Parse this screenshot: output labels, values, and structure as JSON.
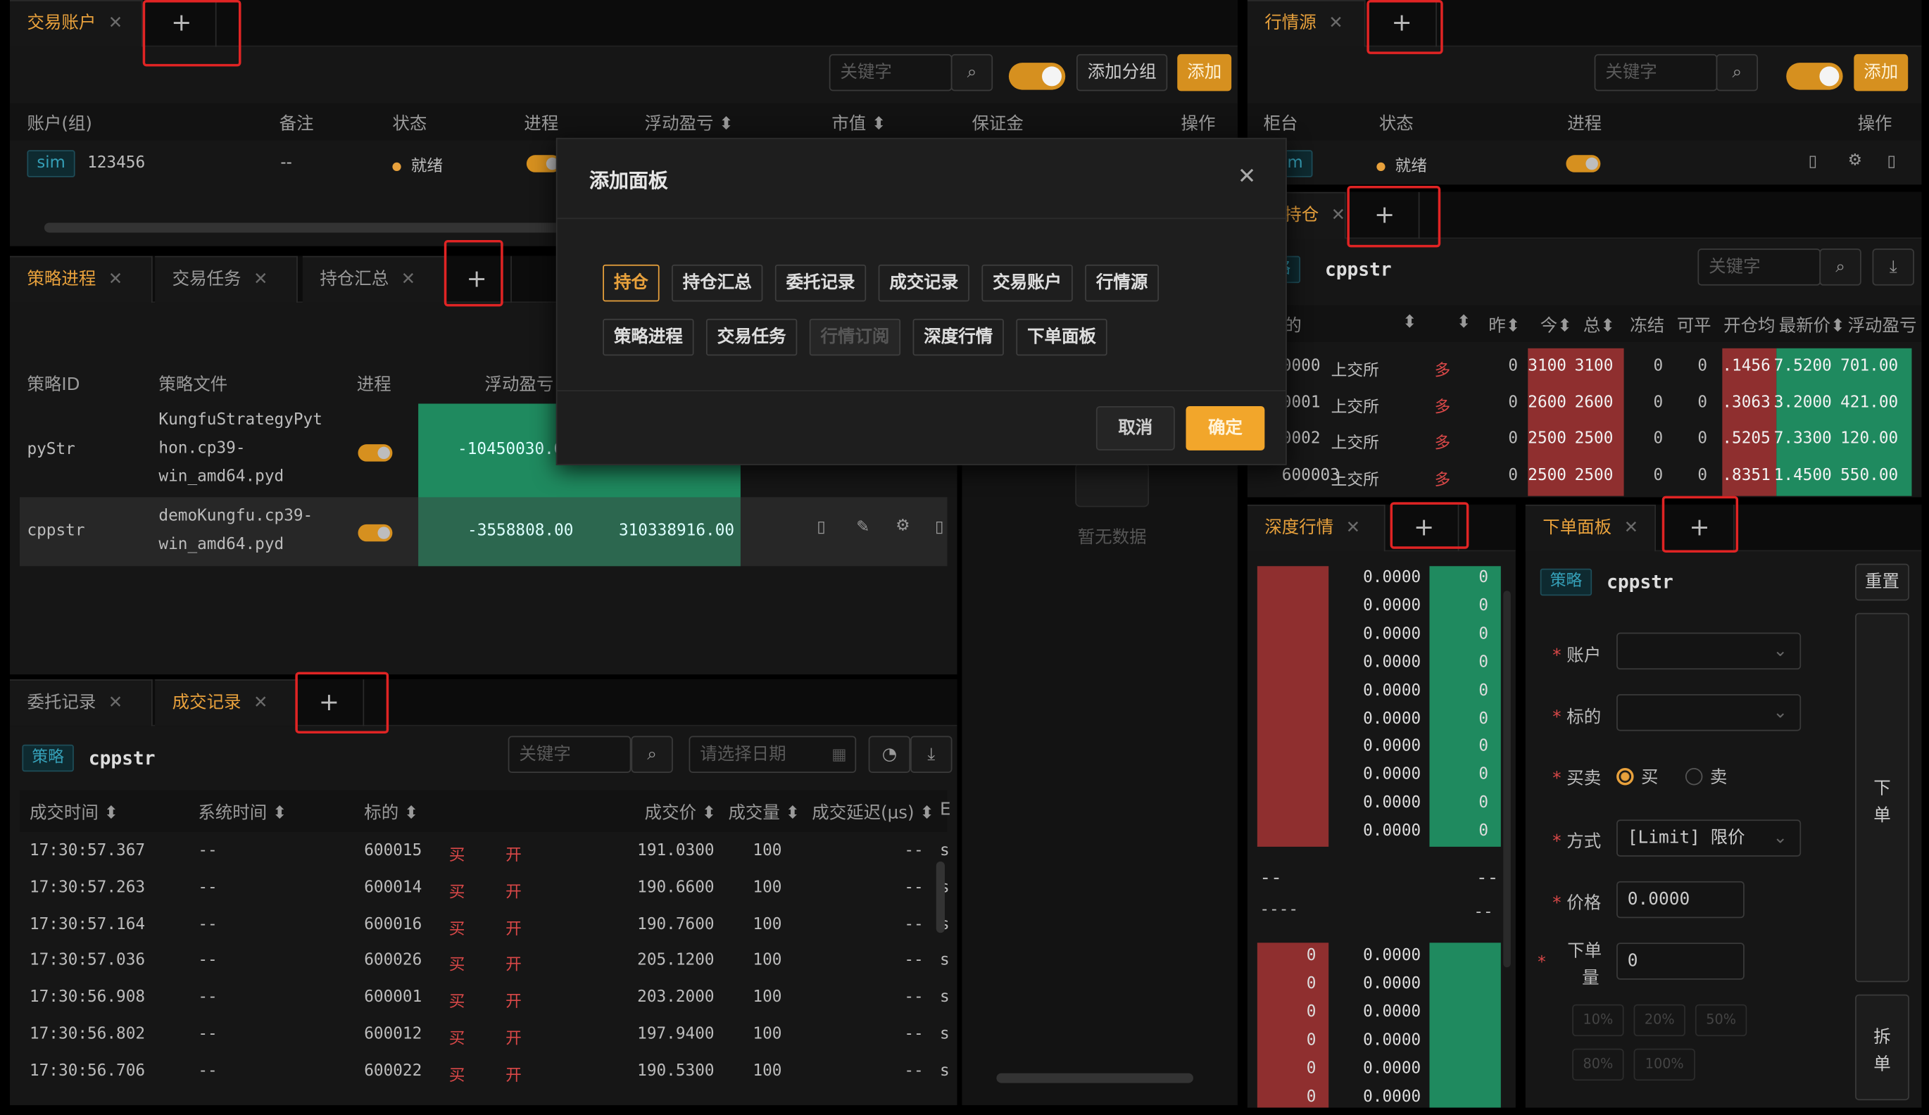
{
  "tabs": {
    "account": [
      {
        "label": "交易账户"
      }
    ],
    "quote_source": [
      {
        "label": "行情源"
      }
    ],
    "strategy": [
      {
        "label": "策略进程"
      },
      {
        "label": "交易任务"
      },
      {
        "label": "持仓汇总"
      }
    ],
    "orders": [
      {
        "label": "委托记录"
      },
      {
        "label": "成交记录"
      }
    ],
    "position": [
      {
        "label": "持仓"
      }
    ],
    "depth": [
      {
        "label": "深度行情"
      }
    ],
    "order_panel": [
      {
        "label": "下单面板"
      }
    ],
    "plus": "+",
    "close": "✕"
  },
  "account_panel": {
    "keyword_placeholder": "关键字",
    "add_group": "添加分组",
    "add": "添加",
    "headers": [
      "账户(组)",
      "备注",
      "状态",
      "进程",
      "浮动盈亏 ⬍",
      "市值 ⬍",
      "保证金",
      "操作"
    ],
    "row": {
      "tag": "sim",
      "id": "123456",
      "note": "--",
      "status": "就绪"
    }
  },
  "quote_panel": {
    "keyword_placeholder": "关键字",
    "add": "添加",
    "headers": [
      "柜台",
      "状态",
      "进程",
      "操作"
    ],
    "row": {
      "tag": "sim",
      "status": "就绪"
    }
  },
  "strategy_panel": {
    "headers": [
      "策略ID",
      "策略文件",
      "进程",
      "浮动盈亏"
    ],
    "rows": [
      {
        "id": "pyStr",
        "file": [
          "KungfuStrategyPyt",
          "hon.cp39-",
          "win_amd64.pyd"
        ],
        "pnl": "-10450030.0"
      },
      {
        "id": "cppstr",
        "file": [
          "demoKungfu.cp39-",
          "win_amd64.pyd"
        ],
        "pnl": "-3558808.00",
        "value": "310338916.00"
      }
    ]
  },
  "trades_panel": {
    "strategy_tag": "策略",
    "strategy_name": "cppstr",
    "keyword_placeholder": "关键字",
    "date_placeholder": "请选择日期",
    "headers": [
      "成交时间 ⬍",
      "系统时间 ⬍",
      "标的 ⬍",
      "成交价 ⬍",
      "成交量 ⬍",
      "成交延迟(μs) ⬍",
      "E"
    ],
    "rows": [
      {
        "t": "17:30:57.367",
        "sys": "--",
        "sym": "600015",
        "side": "买",
        "off": "开",
        "price": "191.0300",
        "vol": "100",
        "lat": "--",
        "e": "s"
      },
      {
        "t": "17:30:57.263",
        "sys": "--",
        "sym": "600014",
        "side": "买",
        "off": "开",
        "price": "190.6600",
        "vol": "100",
        "lat": "--",
        "e": "s"
      },
      {
        "t": "17:30:57.164",
        "sys": "--",
        "sym": "600016",
        "side": "买",
        "off": "开",
        "price": "190.7600",
        "vol": "100",
        "lat": "--",
        "e": "s"
      },
      {
        "t": "17:30:57.036",
        "sys": "--",
        "sym": "600026",
        "side": "买",
        "off": "开",
        "price": "205.1200",
        "vol": "100",
        "lat": "--",
        "e": "s"
      },
      {
        "t": "17:30:56.908",
        "sys": "--",
        "sym": "600001",
        "side": "买",
        "off": "开",
        "price": "203.2000",
        "vol": "100",
        "lat": "--",
        "e": "s"
      },
      {
        "t": "17:30:56.802",
        "sys": "--",
        "sym": "600012",
        "side": "买",
        "off": "开",
        "price": "197.9400",
        "vol": "100",
        "lat": "--",
        "e": "s"
      },
      {
        "t": "17:30:56.706",
        "sys": "--",
        "sym": "600022",
        "side": "买",
        "off": "开",
        "price": "190.5300",
        "vol": "100",
        "lat": "--",
        "e": "s"
      }
    ]
  },
  "middle_panel": {
    "no_data": "暂无数据"
  },
  "position_panel": {
    "strategy_tag": "略",
    "strategy_name": "cppstr",
    "keyword_placeholder": "关键字",
    "headers": [
      "的",
      "⬍",
      "⬍",
      "昨⬍",
      "今⬍",
      "总⬍",
      "冻结",
      "可平",
      "开仓均",
      "最新价⬍",
      "浮动盈亏"
    ],
    "rows": [
      {
        "sym": "0000",
        "ex": "上交所",
        "dir": "多",
        "y": "0",
        "td": "3100",
        "tot": "3100",
        "fz": "0",
        "cl": "0",
        "open": ".1456",
        "last": "7.5200",
        "pnl": "701.00"
      },
      {
        "sym": "0001",
        "ex": "上交所",
        "dir": "多",
        "y": "0",
        "td": "2600",
        "tot": "2600",
        "fz": "0",
        "cl": "0",
        "open": ".3063",
        "last": "3.2000",
        "pnl": "421.00"
      },
      {
        "sym": "0002",
        "ex": "上交所",
        "dir": "多",
        "y": "0",
        "td": "2500",
        "tot": "2500",
        "fz": "0",
        "cl": "0",
        "open": ".5205",
        "last": "7.3300",
        "pnl": "120.00"
      },
      {
        "sym": "600003",
        "ex": "上交所",
        "dir": "多",
        "y": "0",
        "td": "2500",
        "tot": "2500",
        "fz": "0",
        "cl": "0",
        "open": ".8351",
        "last": "1.4500",
        "pnl": "550.00"
      }
    ]
  },
  "depth_panel": {
    "ask_rows": [
      {
        "p": "0.0000",
        "v": "0"
      },
      {
        "p": "0.0000",
        "v": "0"
      },
      {
        "p": "0.0000",
        "v": "0"
      },
      {
        "p": "0.0000",
        "v": "0"
      },
      {
        "p": "0.0000",
        "v": "0"
      },
      {
        "p": "0.0000",
        "v": "0"
      },
      {
        "p": "0.0000",
        "v": "0"
      },
      {
        "p": "0.0000",
        "v": "0"
      },
      {
        "p": "0.0000",
        "v": "0"
      },
      {
        "p": "0.0000",
        "v": "0"
      }
    ],
    "mid_left": "--",
    "mid_right": "--",
    "mid_left2": "----",
    "mid_right2": "--",
    "bid_rows": [
      {
        "v": "0",
        "p": "0.0000"
      },
      {
        "v": "0",
        "p": "0.0000"
      },
      {
        "v": "0",
        "p": "0.0000"
      },
      {
        "v": "0",
        "p": "0.0000"
      },
      {
        "v": "0",
        "p": "0.0000"
      },
      {
        "v": "0",
        "p": "0.0000"
      }
    ]
  },
  "order_panel": {
    "strategy_tag": "策略",
    "strategy_name": "cppstr",
    "reset": "重置",
    "account_label": "账户",
    "symbol_label": "标的",
    "side_label": "买卖",
    "buy": "买",
    "sell": "卖",
    "method_label": "方式",
    "method_value": "[Limit] 限价",
    "price_label": "价格",
    "price_value": "0.0000",
    "qty_label_1": "下单",
    "qty_label_2": "量",
    "qty_value": "0",
    "pct": [
      "10%",
      "20%",
      "50%",
      "80%",
      "100%"
    ],
    "place_1": "下",
    "place_2": "单",
    "split_1": "拆",
    "split_2": "单"
  },
  "dialog": {
    "title": "添加面板",
    "close": "✕",
    "row1": [
      "持仓",
      "持仓汇总",
      "委托记录",
      "成交记录",
      "交易账户",
      "行情源"
    ],
    "row2": [
      "策略进程",
      "交易任务",
      "行情订阅",
      "深度行情",
      "下单面板"
    ],
    "cancel": "取消",
    "confirm": "确定"
  },
  "colors": {
    "accent": "#e8a13c",
    "green": "#1f8a5f",
    "red": "#8f2f2f",
    "redbox": "#e02424"
  }
}
